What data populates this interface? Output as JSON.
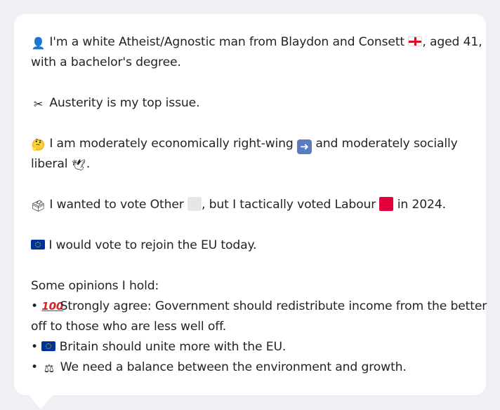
{
  "profile": {
    "identity_line1_pre": "I'm a white Atheist/Agnostic man from Blaydon and Consett",
    "identity_line1_post": ", aged 41,",
    "identity_line2": "with a bachelor's degree.",
    "top_issue": "Austerity is my top issue.",
    "economic_line1_pre": "I am moderately economically right-wing",
    "economic_line1_post": "and moderately socially",
    "economic_line2": "liberal",
    "economic_line2_end": ".",
    "vote_a": "I wanted to vote Other",
    "vote_b": ", but I tactically voted Labour",
    "vote_c": "in 2024.",
    "eu_stance": "I would vote to rejoin the EU today.",
    "opinions_heading": "Some opinions I hold:",
    "opinions": [
      {
        "bullet": "•",
        "line1": "Strongly agree: Government should redistribute income from the better",
        "line2": "off to those who are less well off."
      },
      {
        "bullet": "•",
        "line1": "Britain should unite more with the EU."
      },
      {
        "bullet": "•",
        "line1": "We need a balance between the environment and growth."
      }
    ]
  },
  "icons": {
    "person": "bust-in-silhouette-icon",
    "england_flag": "england-flag-icon",
    "scissors": "scissors-icon",
    "thinking": "thinking-face-icon",
    "right_arrow": "right-arrow-icon",
    "dove": "dove-icon",
    "ballot": "ballot-box-icon",
    "eu_flag": "eu-flag-icon",
    "hundred": "hundred-points-icon",
    "scales": "balance-scale-icon"
  },
  "colors": {
    "labour": "#e4003b",
    "other": "#e6e6e6",
    "eu_blue": "#003399",
    "background": "#eef0f4",
    "card": "#ffffff"
  }
}
